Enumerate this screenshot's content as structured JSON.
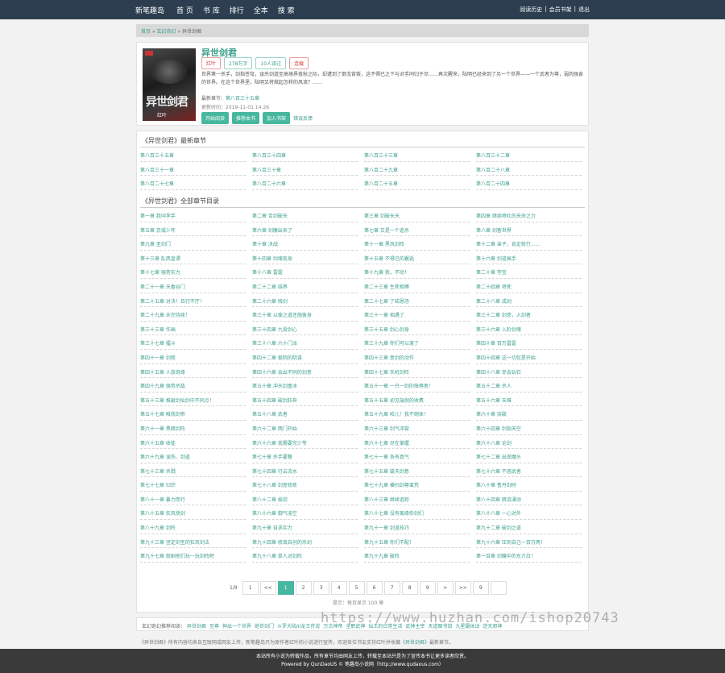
{
  "topbar": {
    "brand": "新笔趣岛",
    "nav": [
      "首 页",
      "书 库",
      "排行",
      "全本",
      "搜 索"
    ],
    "right_links": [
      "阅读历史",
      "会员书架",
      "退出"
    ],
    "sep": "|"
  },
  "breadcrumb": {
    "home": "首页",
    "sep": "»",
    "category": "玄幻奇幻",
    "current": "异世剑君"
  },
  "book": {
    "title": "异世剑君",
    "tags": [
      "红叶",
      "278万字",
      "10人读过",
      "连载"
    ],
    "intro": "世界第一杀手，剑指苍穹，误杀剑道至高境界夜秋之际，却遭到了倒戈背叛，这不得已之下与对手同归于尽……再次醒来，陆明已经来到了另一个世界——一个武者为尊，弱肉强食的世界。在这个世界里，陆明又将掀起怎样的风浪？……",
    "latest_label": "最新章节：",
    "latest_chapter": "第八百三十五章",
    "updated_label": "更新时间：",
    "updated": "2019-11-01 14:26",
    "buttons": [
      "开始阅读",
      "推荐本书",
      "加入书架"
    ],
    "report": "错误反馈",
    "cover_title": "异世剑君",
    "cover_author": "红叶"
  },
  "latest_section": {
    "title": "《异世剑君》最新章节",
    "items": [
      "第八百三十五章",
      "第八百三十四章",
      "第八百三十三章",
      "第八百三十二章",
      "第八百三十一章",
      "第八百三十章",
      "第八百二十九章",
      "第八百二十八章",
      "第八百二十七章",
      "第八百二十六章",
      "第八百二十五章",
      "第八百二十四章"
    ]
  },
  "all_section": {
    "title": "《异世剑君》全部章节目录",
    "items": [
      "第一章 我叫李手",
      "第二章 百剑破天",
      "第三章 剑破长天",
      "第四章 继续喷吐的天命之力",
      "第五章 京城少年",
      "第六章 剑魔出来了",
      "第七章 又是一个追杀",
      "第八章 剑客世界",
      "第九章 圣剑门",
      "第十章 决战",
      "第十一章 黑风剑阵",
      "第十二章 枭子，肯定就行……",
      "第十三章 乱西皇谭",
      "第十四章 剑魂现身",
      "第十五章 不得已的邂逅",
      "第十六章 剑道高手",
      "第十七章 强势实力",
      "第十八章 雷霆",
      "第十九章 我，不动！",
      "第二十章 夺宝",
      "第二十一章 天香谷门",
      "第二十二章 结界",
      "第二十三章 生死相搏",
      "第二十四章 将死",
      "第二十五章 对决！且行不厅！",
      "第二十六章 残剑",
      "第二十七章 了结恩怨",
      "第二十八章 成剑",
      "第二十九章 未完待续！",
      "第三十章 以彼之道还施彼身",
      "第三十一章 相遇了",
      "第三十二章 剑意，入剑者",
      "第三十三章 作画",
      "第三十四章 九霄剑心",
      "第三十五章 剑心剑身",
      "第三十六章 入阶剑魂",
      "第三十七章 擂斗",
      "第三十八章 六十门派",
      "第三十九章 你们可以滚了",
      "第四十章 百万雷霆",
      "第四十一章 剑修",
      "第四十二章 极阴的阴谋",
      "第四十三章 意剑的动作",
      "第四十四章 这一切仅是开始",
      "第四十五章 人族奇缘",
      "第四十六章 会出不同的剑意",
      "第四十七章 天机剑阵",
      "第四十八章 幸会钻石",
      "第四十九章 强势杀敌",
      "第五十章 冲天剑盒冰",
      "第五十一章 一只一剑的侮辱者！",
      "第五十二章 杀人",
      "第五十三章 推敲剑仙剑中不同点！",
      "第五十四章 破剑狂奔",
      "第五十五章 初见端倪的收费",
      "第五十六章 天难",
      "第五十七章 唯我剑帝",
      "第五十八章 武者",
      "第五十九章 哈儿！我不倒体！",
      "第六十章 突破",
      "第六十一章 黑暗剑阵",
      "第六十二章 两门开始",
      "第六十三章 剑气冲霄",
      "第六十四章 剑指天空",
      "第六十五章 收徒",
      "第六十六章 我需要完少爷",
      "第六十七章 尽在掌握",
      "第六十八章 论剑",
      "第六十九章 误伤、剑道",
      "第七十章 杀手要蹩",
      "第七十一章 各有真气",
      "第七十二章 出现魔头",
      "第七十三章 杀戮",
      "第七十四章 行云流水",
      "第七十五章 毁天剑意",
      "第七十六章 不惑武者",
      "第七十七章 归宗",
      "第七十八章 剑意修炼",
      "第七十九章 横扫剑尊蛮荒",
      "第八十章 鲁丹剑时",
      "第八十一章 暴力而行",
      "第八十二章 偷窃",
      "第八十三章 继续追踪",
      "第八十四章 暗流涌动",
      "第八十五章 狂风快剑",
      "第八十六章 御气凌空",
      "第八十七章 没有离缘你剑们",
      "第八十八章 一心对外",
      "第八十九章 剑阵",
      "第九十章 自求实力",
      "第九十一章 剑道技巧",
      "第九十二章 破剑之道",
      "第九十三章 坚定剑圣的狂风剑法",
      "第九十四章 修真自创的杀剑",
      "第九十五章 你们不配！",
      "第九十六章 压到自己一百万两！",
      "第九十七章 就剧他们玩一玩剑阵吧",
      "第九十八章 单人对剑阵",
      "第九十九章 破阵",
      "第一百章 剑魔中的东方白！"
    ]
  },
  "pager": {
    "info": "1/9",
    "pages": [
      "1",
      "<<",
      "1",
      "2",
      "3",
      "4",
      "5",
      "6",
      "7",
      "8",
      "9",
      ">",
      ">>",
      "9",
      ""
    ],
    "active_index": 2,
    "hint": "提示：每页显示 100 章"
  },
  "related": {
    "label": "玄幻奇幻推荐阅读：",
    "items": [
      "异世剑君",
      "至尊",
      "神出一个世界",
      "绝世剑门",
      "斗罗大陆III龙王传说",
      "万古神帝",
      "全职武神",
      "仙王的日常生活",
      "武神主宰",
      "天道图书馆",
      "九星霸体诀",
      "逆天邪神"
    ]
  },
  "disclaimer": {
    "prefix": "《异世剑君》所有内容均来自互联网或网友上传，新笔趣岛只为原作者红叶的小说进行宣传。欢迎各位书友支持红叶并收藏",
    "book_link": "《异世剑君》",
    "suffix": "最新章节。"
  },
  "footer": {
    "line1": "本站所有小说为转载作品，所有章节均由网友上传，转载至本站只是为了宣传本书让更多读者欣赏。",
    "line2": "Powered by QunDaoUS © 笔趣岛小说网（http://www.qudaous.com）"
  },
  "watermark": "https://www.huzhan.com/ishop20743"
}
